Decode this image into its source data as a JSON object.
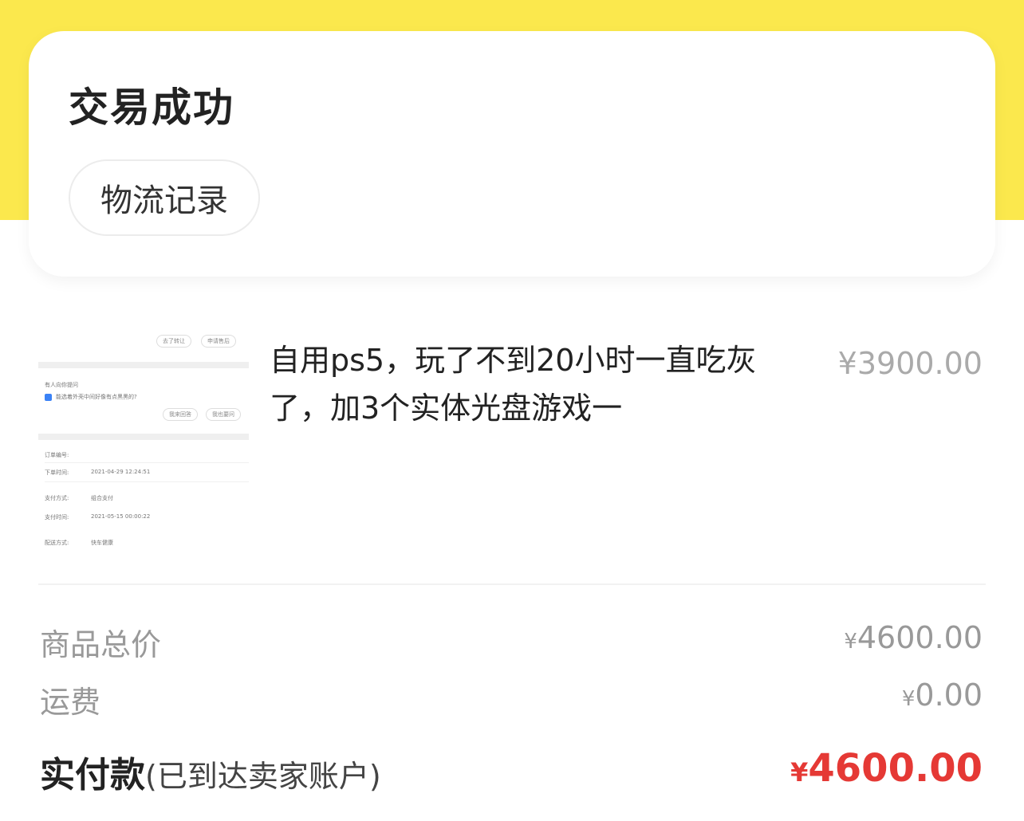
{
  "status": {
    "title": "交易成功",
    "logistics_button": "物流记录"
  },
  "product": {
    "title": "自用ps5，玩了不到20小时一直吃灰了，加3个实体光盘游戏一",
    "price": "¥3900.00",
    "thumbnail": {
      "buttons_top": [
        "去了转让",
        "申请售后"
      ],
      "question_header": "有人向你提问",
      "question_text": "能选着外壳中间好像有点黑黑的?",
      "buttons_mid": [
        "我来回答",
        "我也要问"
      ],
      "rows": [
        {
          "label": "订单编号:",
          "value": ""
        },
        {
          "label": "下单时间:",
          "value": "2021-04-29 12:24:51"
        },
        {
          "label": "支付方式:",
          "value": "组合支付"
        },
        {
          "label": "支付时间:",
          "value": "2021-05-15 00:00:22"
        },
        {
          "label": "配送方式:",
          "value": "快车健康"
        }
      ]
    }
  },
  "fees": {
    "goods_total": {
      "label": "商品总价",
      "currency": "¥",
      "amount": "4600.00"
    },
    "shipping": {
      "label": "运费",
      "currency": "¥",
      "amount": "0.00"
    }
  },
  "total": {
    "label": "实付款",
    "note": "(已到达卖家账户)",
    "currency": "¥",
    "amount": "4600.00"
  },
  "colors": {
    "brand_yellow": "#fbe84d",
    "price_red": "#e53935"
  }
}
